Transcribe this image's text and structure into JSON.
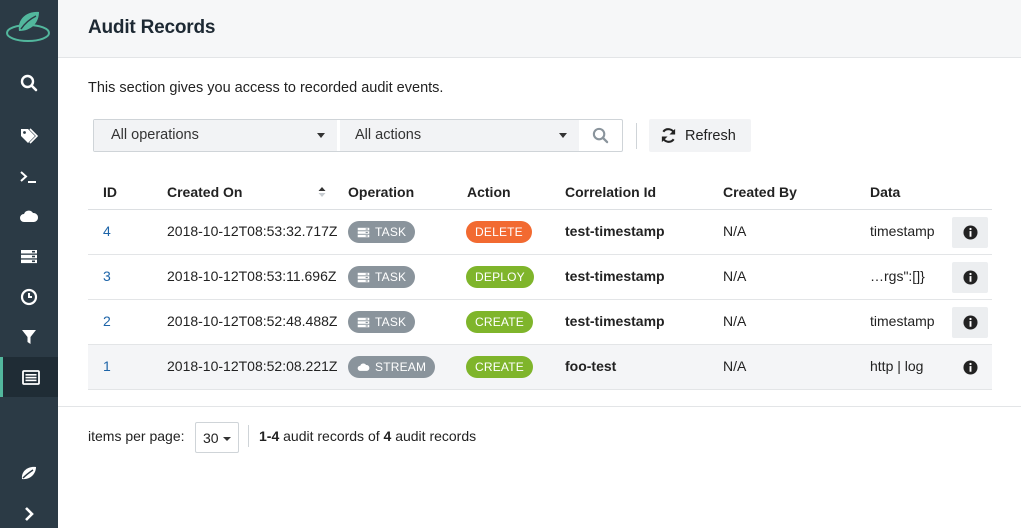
{
  "sidebar": {
    "items": [
      {
        "icon": "search-icon"
      },
      {
        "icon": "tags-icon"
      },
      {
        "icon": "terminal-icon"
      },
      {
        "icon": "cloud-icon"
      },
      {
        "icon": "server-icon"
      },
      {
        "icon": "clock-icon"
      },
      {
        "icon": "filter-icon"
      },
      {
        "icon": "list-alt-icon",
        "active": true
      }
    ],
    "bottom": [
      {
        "icon": "leaf-icon"
      },
      {
        "icon": "expand-chevron-icon"
      }
    ]
  },
  "header": {
    "title": "Audit Records"
  },
  "intro": "This section gives you access to recorded audit events.",
  "toolbar": {
    "operations_value": "All operations",
    "actions_value": "All actions",
    "refresh_label": "Refresh"
  },
  "table": {
    "columns": {
      "id": "ID",
      "created_on": "Created On",
      "operation": "Operation",
      "action": "Action",
      "correlation_id": "Correlation Id",
      "created_by": "Created By",
      "data": "Data"
    },
    "rows": [
      {
        "id": "4",
        "created_on": "2018-10-12T08:53:32.717Z",
        "operation": "TASK",
        "op_icon": "server-icon",
        "action": "DELETE",
        "action_color": "#f26a31",
        "correlation_id": "test-timestamp",
        "created_by": "N/A",
        "data": "timestamp"
      },
      {
        "id": "3",
        "created_on": "2018-10-12T08:53:11.696Z",
        "operation": "TASK",
        "op_icon": "server-icon",
        "action": "DEPLOY",
        "action_color": "#7fb52b",
        "correlation_id": "test-timestamp",
        "created_by": "N/A",
        "data": "…rgs\":[]}"
      },
      {
        "id": "2",
        "created_on": "2018-10-12T08:52:48.488Z",
        "operation": "TASK",
        "op_icon": "server-icon",
        "action": "CREATE",
        "action_color": "#7fb52b",
        "correlation_id": "test-timestamp",
        "created_by": "N/A",
        "data": "timestamp"
      },
      {
        "id": "1",
        "created_on": "2018-10-12T08:52:08.221Z",
        "operation": "STREAM",
        "op_icon": "cloud-icon",
        "action": "CREATE",
        "action_color": "#7fb52b",
        "correlation_id": "foo-test",
        "created_by": "N/A",
        "data": "http | log"
      }
    ]
  },
  "footer": {
    "items_per_page_label": "items per page:",
    "items_per_page_value": "30",
    "range": "1-4",
    "mid_text": " audit records of ",
    "total": "4",
    "end_text": " audit records"
  },
  "colors": {
    "sidebar": "#2b3a45",
    "link": "#1d64a8",
    "accent": "#52b79d"
  }
}
